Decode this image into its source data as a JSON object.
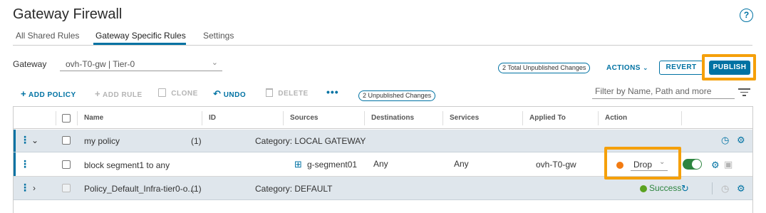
{
  "page": {
    "title": "Gateway Firewall",
    "help_icon": "?"
  },
  "tabs": [
    {
      "label": "All Shared Rules",
      "active": false
    },
    {
      "label": "Gateway Specific Rules",
      "active": true
    },
    {
      "label": "Settings",
      "active": false
    }
  ],
  "gateway": {
    "label": "Gateway",
    "value": "ovh-T0-gw | Tier-0"
  },
  "header_actions": {
    "total_unpublished": "2 Total Unpublished Changes",
    "actions_label": "ACTIONS",
    "revert_label": "REVERT",
    "publish_label": "PUBLISH"
  },
  "toolbar": {
    "add_policy": "ADD POLICY",
    "add_rule": "ADD RULE",
    "clone": "CLONE",
    "undo": "UNDO",
    "delete": "DELETE",
    "more": "•••",
    "unpublished": "2 Unpublished Changes",
    "filter_placeholder": "Filter by Name, Path and more"
  },
  "columns": {
    "name": "Name",
    "id": "ID",
    "sources": "Sources",
    "destinations": "Destinations",
    "services": "Services",
    "applied_to": "Applied To",
    "action": "Action"
  },
  "rows": {
    "policy": {
      "name": "my policy",
      "count": "(1)",
      "category": "Category: LOCAL GATEWAY"
    },
    "rule": {
      "name": "block segment1 to any",
      "source": "g-segment01",
      "destination": "Any",
      "service": "Any",
      "applied_to": "ovh-T0-gw",
      "action": "Drop",
      "enabled": true
    },
    "default_policy": {
      "name": "Policy_Default_Infra-tier0-o...",
      "count": "(1)",
      "category": "Category: DEFAULT",
      "status": "Success"
    }
  },
  "colors": {
    "accent": "#0072a3",
    "highlight": "#f5a00a",
    "drop": "#f27b12",
    "success": "#5aa220",
    "toggle_on": "#2e8540",
    "policy_row_bg": "#dfe6ec"
  }
}
